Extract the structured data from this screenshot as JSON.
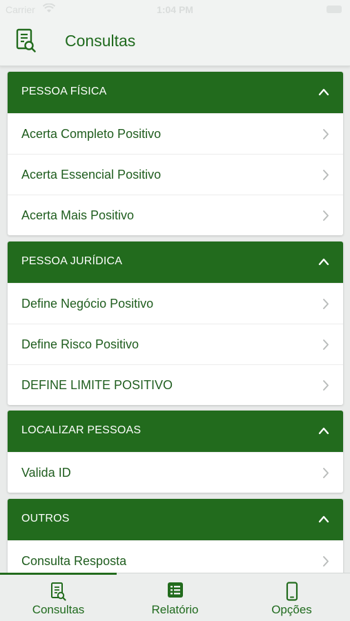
{
  "status_bar": {
    "carrier": "Carrier",
    "time": "1:04 PM"
  },
  "header": {
    "title": "Consultas"
  },
  "sections": [
    {
      "title": "PESSOA FÍSICA",
      "items": [
        "Acerta Completo Positivo",
        "Acerta Essencial Positivo",
        "Acerta Mais Positivo"
      ]
    },
    {
      "title": "PESSOA JURÍDICA",
      "items": [
        "Define Negócio Positivo",
        "Define Risco Positivo",
        "DEFINE LIMITE POSITIVO"
      ]
    },
    {
      "title": "LOCALIZAR PESSOAS",
      "items": [
        "Valida ID"
      ]
    },
    {
      "title": "OUTROS",
      "items": [
        "Consulta Resposta"
      ]
    }
  ],
  "tabs": [
    {
      "label": "Consultas",
      "icon": "document-search-icon"
    },
    {
      "label": "Relatório",
      "icon": "list-icon"
    },
    {
      "label": "Opções",
      "icon": "phone-icon"
    }
  ],
  "colors": {
    "accent": "#226b1d",
    "text": "#1f5d1e",
    "background": "#e9ebea"
  }
}
